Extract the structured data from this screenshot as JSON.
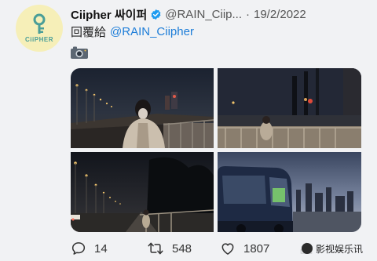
{
  "tweet": {
    "avatar_label": "CiiPHER",
    "display_name": "Ciipher 싸이퍼",
    "handle": "@RAIN_Ciip...",
    "separator": "·",
    "date": "19/2/2022",
    "reply_prefix": "回覆給",
    "reply_to": "@RAIN_Ciipher",
    "attachment_icon": "camera-emoji",
    "photos": [
      {
        "name": "night-bridge-person"
      },
      {
        "name": "city-night-railing"
      },
      {
        "name": "street-lights-road"
      },
      {
        "name": "bus-city-skyline"
      }
    ]
  },
  "actions": {
    "reply_count": "14",
    "retweet_count": "548",
    "like_count": "1807"
  },
  "watermark": {
    "text": "影视娱乐讯"
  },
  "colors": {
    "avatar_bg": "#f6efb8",
    "brand_teal": "#4a9e98",
    "link_blue": "#1d7dd8",
    "verified_blue": "#1d9bf0"
  }
}
